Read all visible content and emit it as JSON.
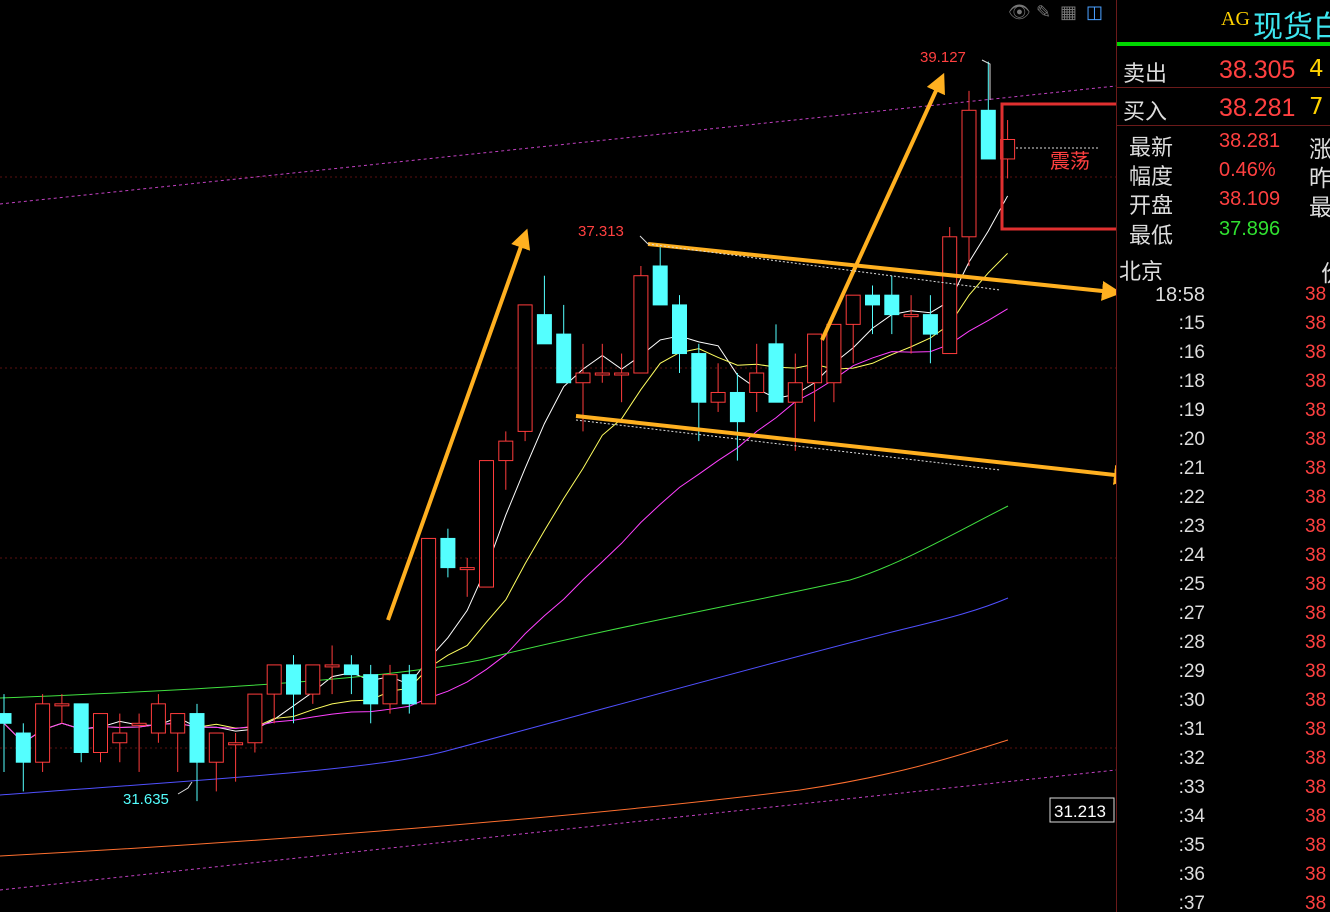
{
  "toolbar": {
    "icons": [
      "eye-slash-icon",
      "pencil-icon",
      "grid-icon",
      "panel-icon"
    ]
  },
  "chart": {
    "labels": {
      "high": "39.127",
      "swing_high": "37.313",
      "low": "31.635",
      "current_axis": "31.213",
      "annotation": "震荡"
    },
    "colors": {
      "up": "#ff3c3c",
      "down": "#54ffff",
      "arrow": "#ffb020",
      "ma5": "#ffffff",
      "ma10": "#ffff60",
      "ma20": "#ff40ff",
      "ma60": "#40e040",
      "ma120": "#5050ff",
      "ma250": "#ff7030",
      "channel": "#c040c0"
    }
  },
  "chart_data": {
    "type": "candlestick",
    "symbol": "AG",
    "price_axis_label": "31.213",
    "candles": [
      [
        32.4,
        32.6,
        31.8,
        32.3
      ],
      [
        32.2,
        32.3,
        31.6,
        31.9
      ],
      [
        31.9,
        32.6,
        31.8,
        32.5
      ],
      [
        32.5,
        32.6,
        32.3,
        32.5
      ],
      [
        32.5,
        32.5,
        31.9,
        32.0
      ],
      [
        32.0,
        32.3,
        31.9,
        32.4
      ],
      [
        32.1,
        32.4,
        31.9,
        32.2
      ],
      [
        32.3,
        32.4,
        31.8,
        32.3
      ],
      [
        32.2,
        32.6,
        32.1,
        32.5
      ],
      [
        32.2,
        32.4,
        31.8,
        32.4
      ],
      [
        32.4,
        32.5,
        31.5,
        31.9
      ],
      [
        31.9,
        32.2,
        31.6,
        32.2
      ],
      [
        32.1,
        32.2,
        31.7,
        32.1
      ],
      [
        32.1,
        32.6,
        32.0,
        32.6
      ],
      [
        32.6,
        32.9,
        32.3,
        32.9
      ],
      [
        32.9,
        33.0,
        32.3,
        32.6
      ],
      [
        32.6,
        32.9,
        32.5,
        32.9
      ],
      [
        32.9,
        33.1,
        32.6,
        32.9
      ],
      [
        32.9,
        33.0,
        32.6,
        32.8
      ],
      [
        32.8,
        32.9,
        32.3,
        32.5
      ],
      [
        32.5,
        32.9,
        32.4,
        32.8
      ],
      [
        32.8,
        32.9,
        32.4,
        32.5
      ],
      [
        32.5,
        34.2,
        32.5,
        34.2
      ],
      [
        34.2,
        34.3,
        33.8,
        33.9
      ],
      [
        33.9,
        34.0,
        33.6,
        33.9
      ],
      [
        33.7,
        35.0,
        33.7,
        35.0
      ],
      [
        35.0,
        35.3,
        34.7,
        35.2
      ],
      [
        35.3,
        36.6,
        35.2,
        36.6
      ],
      [
        36.5,
        36.9,
        36.3,
        36.2
      ],
      [
        36.3,
        36.6,
        35.9,
        35.8
      ],
      [
        35.8,
        36.2,
        35.3,
        35.9
      ],
      [
        35.9,
        36.2,
        35.8,
        35.9
      ],
      [
        35.9,
        36.1,
        35.6,
        35.9
      ],
      [
        35.9,
        37.0,
        35.9,
        36.9
      ],
      [
        37.0,
        37.2,
        36.8,
        36.6
      ],
      [
        36.6,
        36.7,
        35.9,
        36.1
      ],
      [
        36.1,
        36.2,
        35.2,
        35.6
      ],
      [
        35.6,
        36.0,
        35.5,
        35.7
      ],
      [
        35.7,
        35.9,
        35.0,
        35.4
      ],
      [
        35.7,
        36.2,
        35.5,
        35.9
      ],
      [
        36.2,
        36.4,
        35.7,
        35.6
      ],
      [
        35.6,
        36.1,
        35.1,
        35.8
      ],
      [
        35.8,
        36.3,
        35.4,
        36.3
      ],
      [
        35.8,
        36.4,
        35.6,
        36.4
      ],
      [
        36.4,
        36.7,
        36.0,
        36.7
      ],
      [
        36.7,
        36.8,
        36.3,
        36.6
      ],
      [
        36.7,
        36.9,
        36.3,
        36.5
      ],
      [
        36.5,
        36.7,
        36.1,
        36.5
      ],
      [
        36.5,
        36.7,
        36.0,
        36.3
      ],
      [
        36.1,
        37.4,
        36.1,
        37.3
      ],
      [
        37.3,
        38.8,
        37.0,
        38.6
      ],
      [
        38.6,
        39.1,
        38.2,
        38.1
      ],
      [
        38.1,
        38.5,
        37.9,
        38.3
      ]
    ]
  },
  "panel": {
    "symbol": "AG",
    "title": "现货白",
    "rows": [
      {
        "label": "卖出",
        "value": "38.305",
        "extra": "4"
      },
      {
        "label": "买入",
        "value": "38.281",
        "extra": "7"
      },
      {
        "label": "最新",
        "value": "38.281",
        "extra": "涨"
      },
      {
        "label": "幅度",
        "value": "0.46%",
        "extra": "昨"
      },
      {
        "label": "开盘",
        "value": "38.109",
        "extra": "最"
      },
      {
        "label": "最低",
        "value": "37.896",
        "extra": ""
      }
    ],
    "city": "北京",
    "city_extra": "价",
    "ticks": [
      {
        "time": "18:58",
        "price": "38"
      },
      {
        "time": ":15",
        "price": "38"
      },
      {
        "time": ":16",
        "price": "38"
      },
      {
        "time": ":18",
        "price": "38"
      },
      {
        "time": ":19",
        "price": "38"
      },
      {
        "time": ":20",
        "price": "38"
      },
      {
        "time": ":21",
        "price": "38"
      },
      {
        "time": ":22",
        "price": "38"
      },
      {
        "time": ":23",
        "price": "38"
      },
      {
        "time": ":24",
        "price": "38"
      },
      {
        "time": ":25",
        "price": "38"
      },
      {
        "time": ":27",
        "price": "38"
      },
      {
        "time": ":28",
        "price": "38"
      },
      {
        "time": ":29",
        "price": "38"
      },
      {
        "time": ":30",
        "price": "38"
      },
      {
        "time": ":31",
        "price": "38"
      },
      {
        "time": ":32",
        "price": "38"
      },
      {
        "time": ":33",
        "price": "38"
      },
      {
        "time": ":34",
        "price": "38"
      },
      {
        "time": ":35",
        "price": "38"
      },
      {
        "time": ":36",
        "price": "38"
      },
      {
        "time": ":37",
        "price": "38"
      }
    ]
  }
}
